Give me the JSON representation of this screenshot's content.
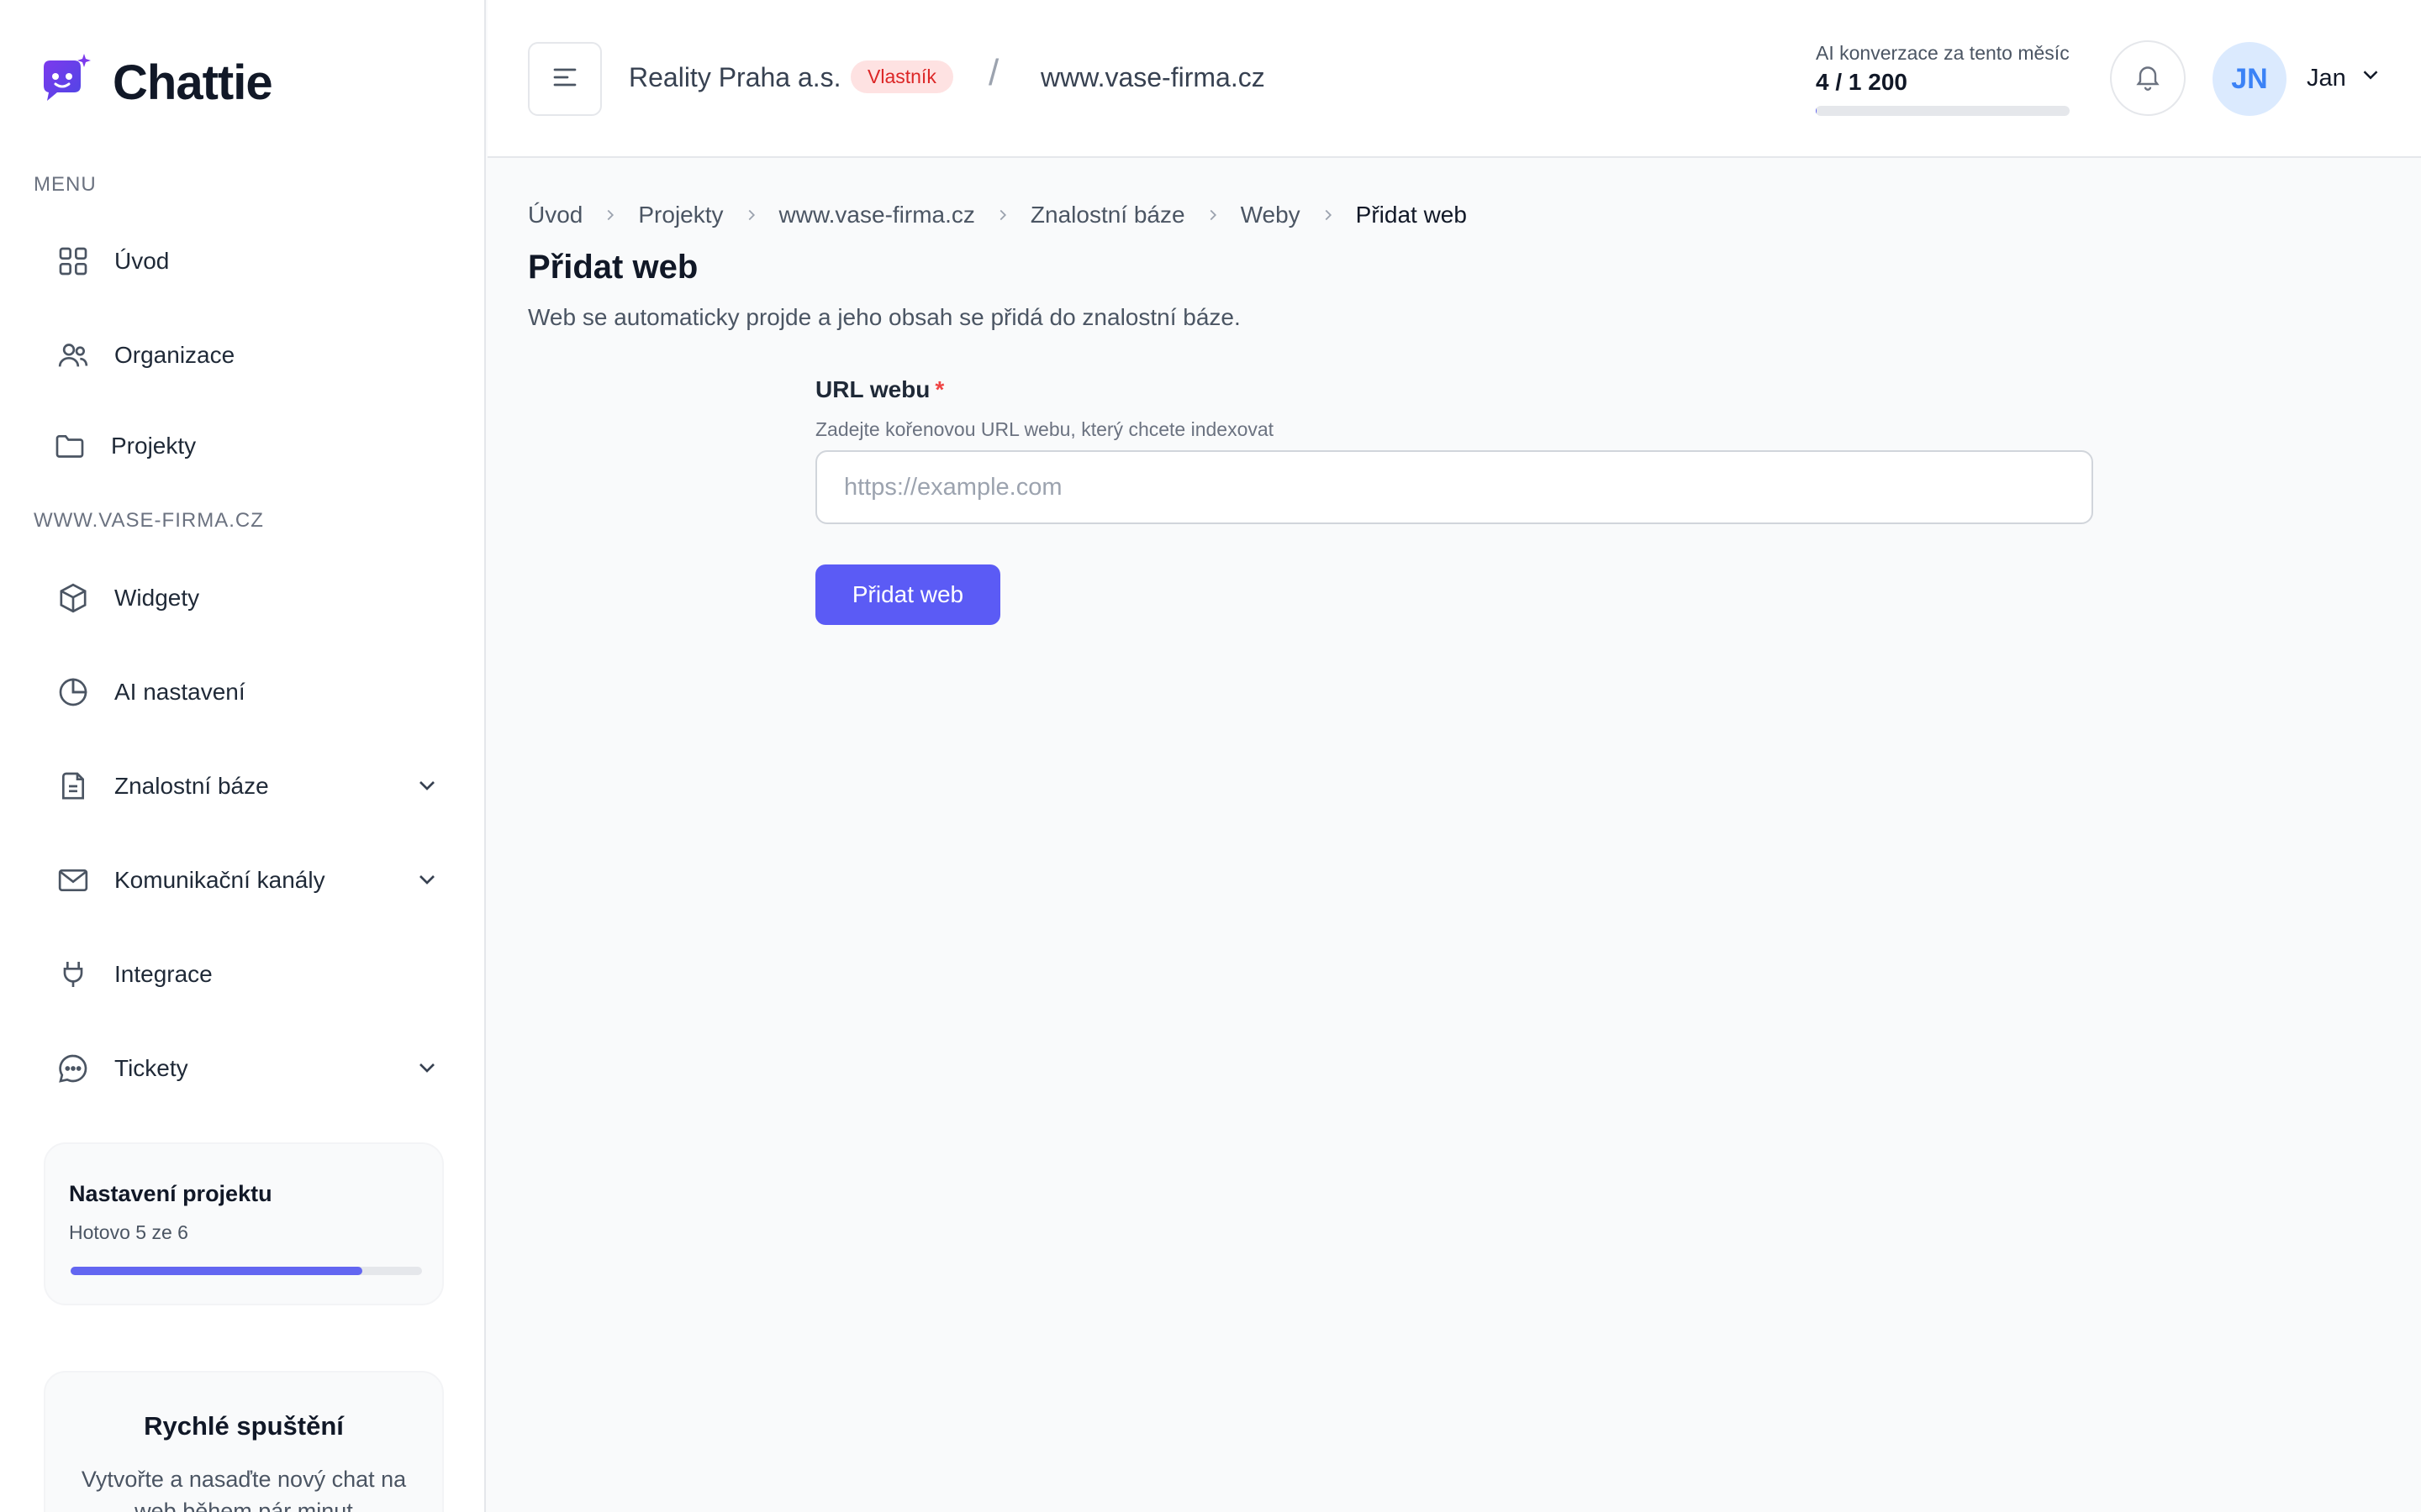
{
  "app": {
    "name": "Chattie"
  },
  "sidebar": {
    "menu_label": "MENU",
    "menu_items": [
      {
        "label": "Úvod",
        "icon": "grid-icon"
      },
      {
        "label": "Organizace",
        "icon": "users-icon"
      },
      {
        "label": "Projekty",
        "icon": "folder-icon"
      }
    ],
    "project_label": "WWW.VASE-FIRMA.CZ",
    "project_items": [
      {
        "label": "Widgety",
        "icon": "cube-icon"
      },
      {
        "label": "AI nastavení",
        "icon": "pie-chart-icon"
      },
      {
        "label": "Znalostní báze",
        "icon": "document-icon",
        "expandable": true
      },
      {
        "label": "Komunikační kanály",
        "icon": "mail-icon",
        "expandable": true
      },
      {
        "label": "Integrace",
        "icon": "plug-icon"
      },
      {
        "label": "Tickety",
        "icon": "chat-bubble-icon",
        "expandable": true
      }
    ],
    "setup_card": {
      "title": "Nastavení projektu",
      "subtitle": "Hotovo 5 ze 6",
      "progress": 0.83
    },
    "quickstart_card": {
      "title": "Rychlé spuštění",
      "text": "Vytvořte a nasaďte nový chat na web během pár minut"
    }
  },
  "header": {
    "organization": "Reality Praha a.s.",
    "role_badge": "Vlastník",
    "separator": "/",
    "project": "www.vase-firma.cz",
    "usage": {
      "label": "AI konverzace za tento měsíc",
      "value": "4 / 1 200",
      "fraction": 0.0033
    },
    "user": {
      "initials": "JN",
      "name": "Jan"
    }
  },
  "breadcrumb": [
    "Úvod",
    "Projekty",
    "www.vase-firma.cz",
    "Znalostní báze",
    "Weby",
    "Přidat web"
  ],
  "page": {
    "title": "Přidat web",
    "description": "Web se automaticky projde a jeho obsah se přidá do znalostní báze."
  },
  "form": {
    "url_label": "URL webu",
    "required_mark": "*",
    "url_help": "Zadejte kořenovou URL webu, který chcete indexovat",
    "url_placeholder": "https://example.com",
    "url_value": "",
    "submit_label": "Přidat web"
  },
  "colors": {
    "accent": "#5b5bf5",
    "badge_bg": "#fee2e2",
    "badge_text": "#dc2626",
    "avatar_bg": "#dbeafe",
    "avatar_text": "#3b82f6"
  }
}
